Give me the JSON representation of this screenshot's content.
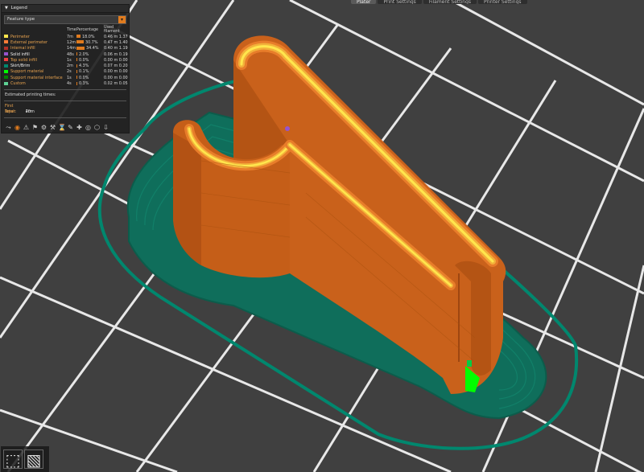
{
  "topbar": {
    "tabs": [
      "Plater",
      "Print Settings",
      "Filament Settings",
      "Printer Settings"
    ]
  },
  "legend": {
    "title": "Legend",
    "view_type": "Feature type",
    "columns": {
      "time": "Time",
      "percentage": "Percentage",
      "used_filament": "Used filament"
    },
    "rows": [
      {
        "name": "Perimeter",
        "color": "#ffe64d",
        "time": "7m",
        "percent": "18.0%",
        "pct": 18.0,
        "length": "0.46 m",
        "weight": "1.37 g",
        "highlight": false
      },
      {
        "name": "External perimeter",
        "color": "#ff7d38",
        "time": "12m",
        "percent": "30.7%",
        "pct": 30.7,
        "length": "0.47 m",
        "weight": "1.40 g",
        "highlight": false
      },
      {
        "name": "Internal infill",
        "color": "#b03029",
        "time": "14m",
        "percent": "34.4%",
        "pct": 34.4,
        "length": "0.40 m",
        "weight": "1.19 g",
        "highlight": false
      },
      {
        "name": "Solid infill",
        "color": "#9654cc",
        "time": "48s",
        "percent": "2.0%",
        "pct": 2.0,
        "length": "0.06 m",
        "weight": "0.19 g",
        "highlight": true
      },
      {
        "name": "Top solid infill",
        "color": "#f04040",
        "time": "1s",
        "percent": "0.0%",
        "pct": 0.0,
        "length": "0.00 m",
        "weight": "0.00 g",
        "highlight": false
      },
      {
        "name": "Skirt/Brim",
        "color": "#00876e",
        "time": "2m",
        "percent": "4.3%",
        "pct": 4.3,
        "length": "0.07 m",
        "weight": "0.20 g",
        "highlight": true
      },
      {
        "name": "Support material",
        "color": "#00ff00",
        "time": "2s",
        "percent": "0.1%",
        "pct": 0.1,
        "length": "0.00 m",
        "weight": "0.00 g",
        "highlight": false
      },
      {
        "name": "Support material interface",
        "color": "#008000",
        "time": "1s",
        "percent": "0.0%",
        "pct": 0.0,
        "length": "0.00 m",
        "weight": "0.00 g",
        "highlight": false
      },
      {
        "name": "Custom",
        "color": "#5ed194",
        "time": "4s",
        "percent": "0.3%",
        "pct": 0.3,
        "length": "0.02 m",
        "weight": "0.05 g",
        "highlight": false
      }
    ],
    "estimated_label": "Estimated printing times:",
    "times": [
      {
        "label": "First layer:",
        "value": "2m"
      },
      {
        "label": "Total:",
        "value": "40m"
      }
    ],
    "toolbar_icons": [
      "travel-icon",
      "wipe-icon",
      "retractions-icon",
      "deretractions-icon",
      "seams-icon",
      "tool-changes-icon",
      "color-changes-icon",
      "pause-prints-icon",
      "custom-gcodes-icon",
      "center-of-gravity-icon",
      "shells-icon",
      "tool-marker-icon"
    ]
  },
  "viewcube": {
    "icons": [
      "cube-wire-icon",
      "cube-solid-icon"
    ]
  }
}
